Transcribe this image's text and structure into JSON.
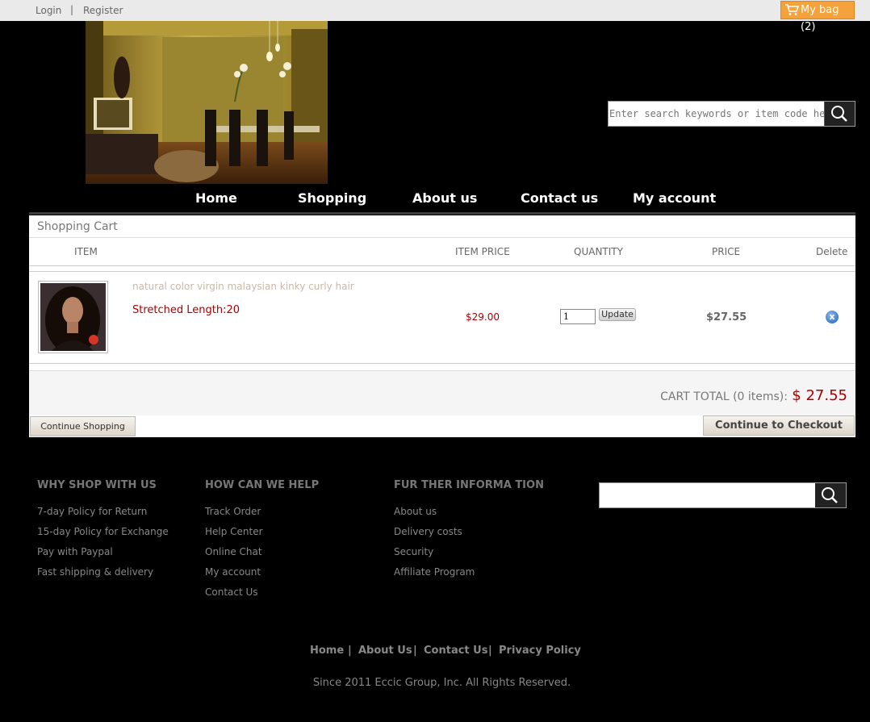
{
  "topbar": {
    "login": "Login",
    "separator": "|",
    "register": "Register",
    "bag": "My bag (2)"
  },
  "header": {
    "search_placeholder": "Enter search keywords or item code here"
  },
  "nav": {
    "items": [
      "Home",
      "Shopping",
      "About us",
      "Contact us",
      "My account"
    ]
  },
  "cart": {
    "title": "Shopping Cart",
    "columns": {
      "item": "ITEM",
      "item_price": "ITEM PRICE",
      "quantity": "QUANTITY",
      "price": "PRICE",
      "delete": "Delete"
    },
    "items": [
      {
        "name": "natural color virgin malaysian kinky curly hair",
        "option": "Stretched Length:20",
        "item_price": "$29.00",
        "quantity": "1",
        "update_label": "Update",
        "price": "$27.55",
        "delete_icon": "x"
      }
    ],
    "total_label": "CART TOTAL (0 items):",
    "total_amount": "$ 27.55",
    "continue_label": "Continue Shopping",
    "checkout_label": "Continue to Checkout"
  },
  "footer": {
    "col1": {
      "heading": "WHY SHOP WITH US",
      "links": [
        "7-day Policy for Return",
        "15-day Policy for Exchange",
        "Pay with Paypal",
        "Fast shipping & delivery"
      ]
    },
    "col2": {
      "heading": "HOW CAN WE HELP",
      "links": [
        "Track Order",
        "Help Center",
        "Online Chat",
        "My account",
        "Contact Us"
      ]
    },
    "col3": {
      "heading": "FUR THER INFORMA TION",
      "links": [
        "About us",
        "Delivery costs",
        "Security",
        "Affiliate Program"
      ]
    },
    "bottom_nav": [
      "Home",
      "|",
      "About Us",
      "|",
      "Contact Us",
      "|",
      "Privacy Policy"
    ],
    "copyright": "Since 2011 Eccic Group, Inc. All Rights Reserved."
  }
}
